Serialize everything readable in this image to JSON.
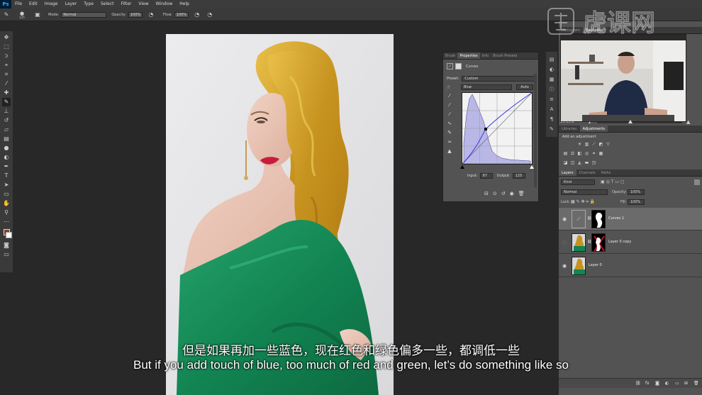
{
  "app": {
    "logo": "Ps",
    "menu": [
      "File",
      "Edit",
      "Image",
      "Layer",
      "Type",
      "Select",
      "Filter",
      "View",
      "Window",
      "Help"
    ]
  },
  "options_bar": {
    "brush_size": "125",
    "mode_label": "Mode:",
    "mode_value": "Normal",
    "opacity_label": "Opacity:",
    "opacity_value": "100%",
    "flow_label": "Flow:",
    "flow_value": "100%"
  },
  "properties": {
    "tabs": [
      "Brush",
      "Properties",
      "Info",
      "Brush Presets"
    ],
    "active_tab": "Properties",
    "title": "Curves",
    "preset_label": "Preset:",
    "preset_value": "Custom",
    "channel_value": "Blue",
    "auto_label": "Auto",
    "input_label": "Input:",
    "input_value": "87",
    "output_label": "Output:",
    "output_value": "125"
  },
  "right_panels": {
    "top_tabs": [
      "Histogram",
      "Navigator"
    ],
    "zoom_value": "15.15%",
    "mid_tabs": [
      "Libraries",
      "Adjustments"
    ],
    "add_adjustment": "Add an adjustment",
    "layer_tabs": [
      "Layers",
      "Channels",
      "Paths"
    ],
    "kind_value": "Kind",
    "blend_value": "Normal",
    "opacity_label": "Opacity:",
    "opacity_value": "100%",
    "lock_label": "Lock:",
    "fill_label": "Fill:",
    "fill_value": "100%",
    "layers": [
      {
        "name": "Curves 1",
        "selected": true
      },
      {
        "name": "Layer 0 copy",
        "selected": false
      },
      {
        "name": "Layer 0",
        "selected": false
      }
    ]
  },
  "subtitles": {
    "chinese": "但是如果再加一些蓝色，现在红色和绿色偏多一些，都调低一些",
    "english": "But if you add touch of blue, too much of red and green, let’s do something like so"
  },
  "watermark": {
    "text": "虎课网"
  },
  "colors": {
    "foreground": "#7b3d2a",
    "background": "#ffffff",
    "panel": "#535353",
    "dark": "#282828",
    "curve_histogram": "#b9b7e6"
  }
}
